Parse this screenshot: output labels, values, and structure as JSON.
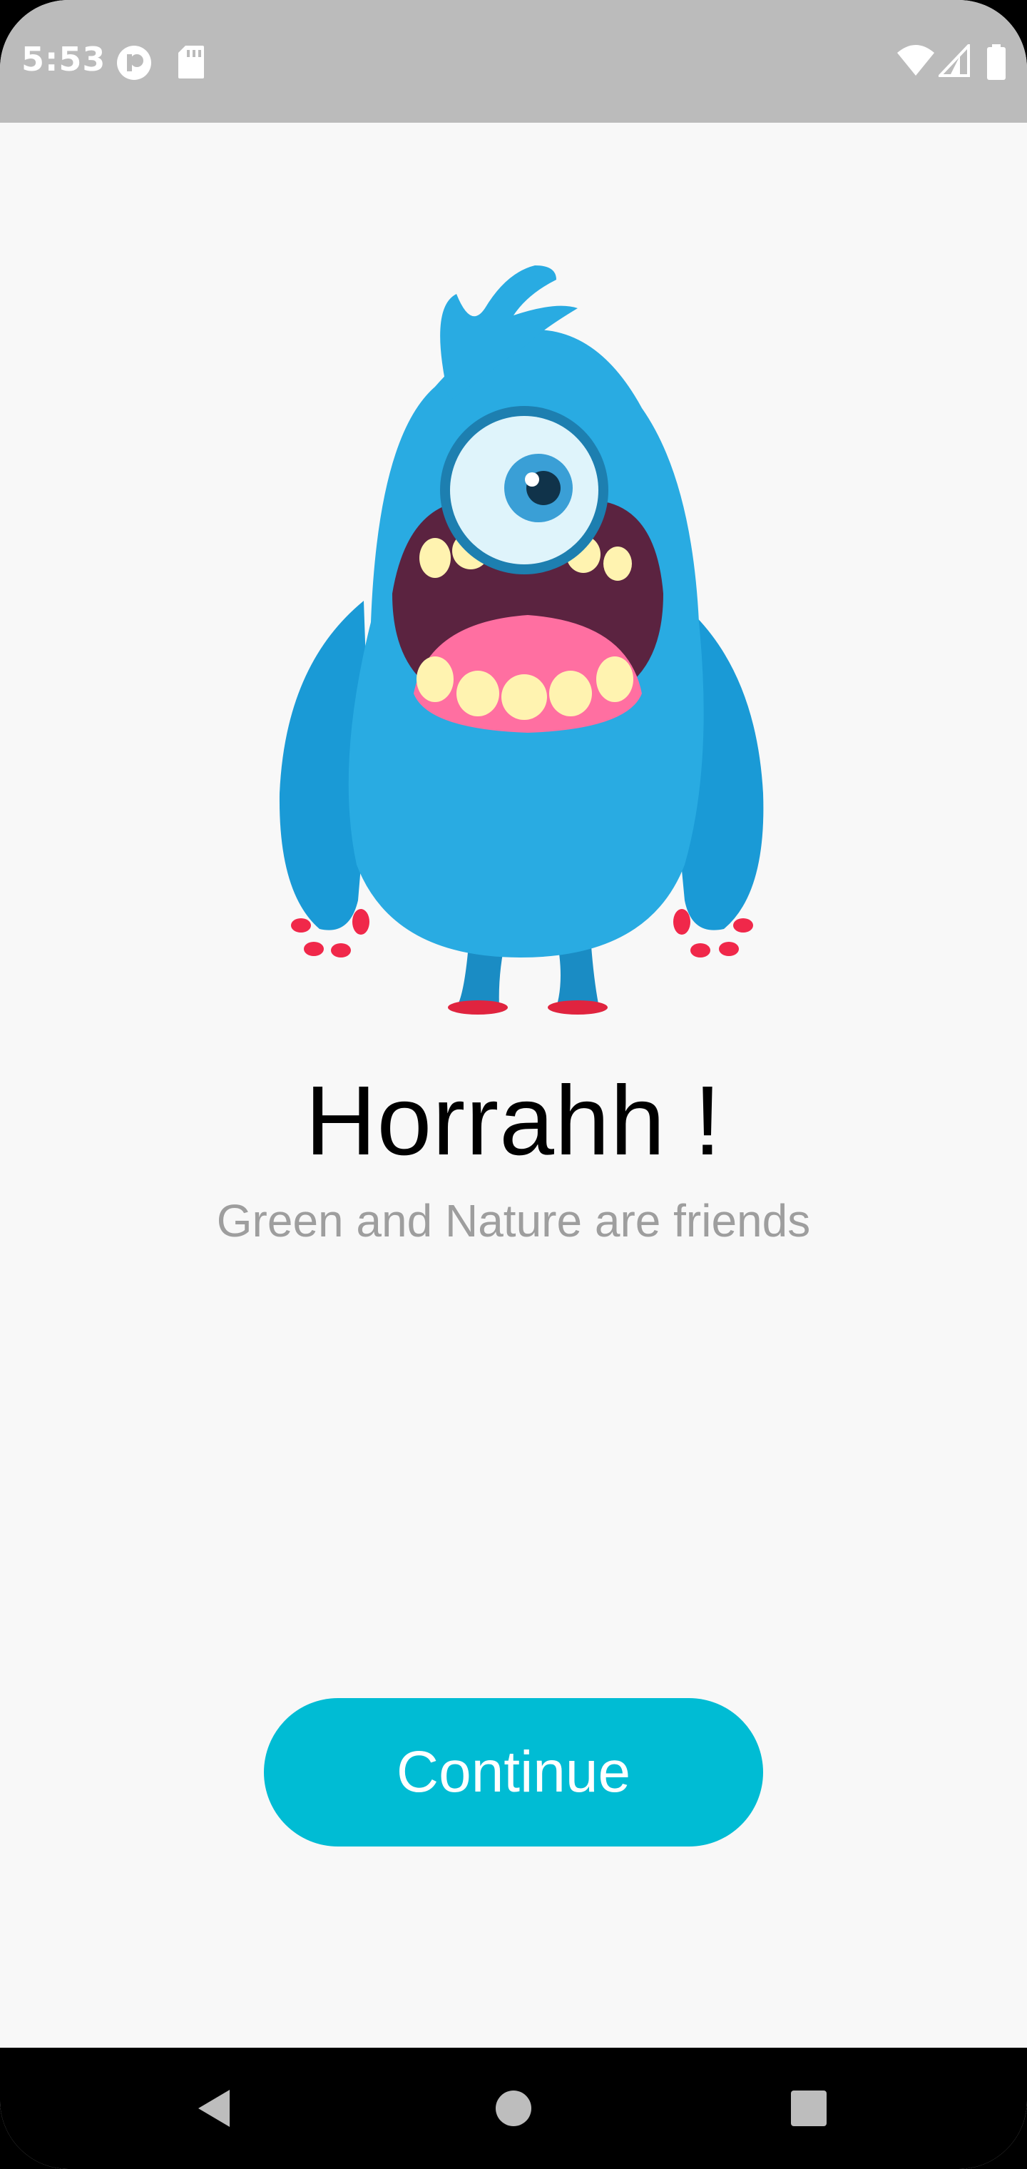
{
  "status_bar": {
    "time": "5:53",
    "icons": [
      "privacy-dot-icon",
      "sd-card-icon",
      "wifi-icon",
      "signal-icon",
      "battery-icon"
    ]
  },
  "onboarding": {
    "illustration": "one-eyed-blue-monster",
    "title": "Horrahh !",
    "subtitle": "Green and Nature are friends",
    "continue_label": "Continue"
  },
  "nav_bar": {
    "icons": [
      "back-icon",
      "home-icon",
      "recents-icon"
    ]
  },
  "colors": {
    "accent": "#00bcd4",
    "status_bar": "#bbbbbb",
    "background": "#f8f8f8",
    "subtitle_text": "#9e9e9e",
    "monster_fur": "#29abe2"
  }
}
